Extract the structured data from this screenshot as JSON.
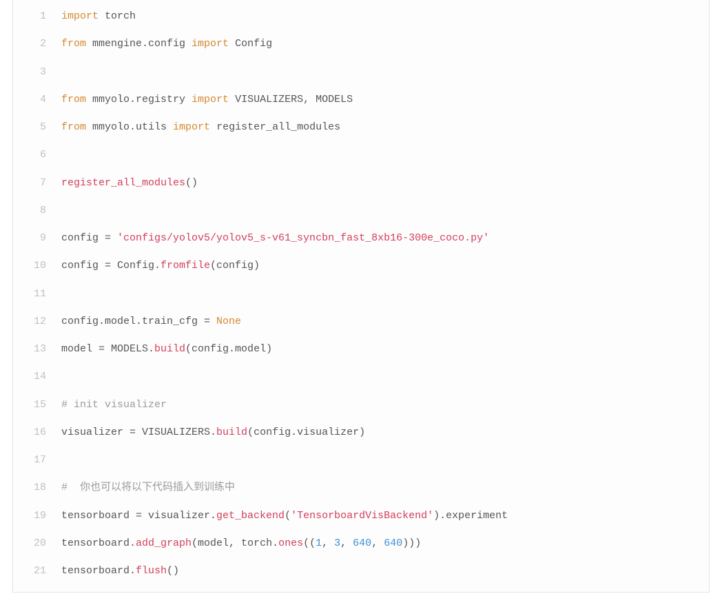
{
  "code": {
    "lines": [
      {
        "n": "1",
        "tokens": [
          {
            "cls": "tok-k",
            "t": "import"
          },
          {
            "cls": "tok-p",
            "t": " torch"
          }
        ]
      },
      {
        "n": "2",
        "tokens": [
          {
            "cls": "tok-k",
            "t": "from"
          },
          {
            "cls": "tok-p",
            "t": " mmengine.config "
          },
          {
            "cls": "tok-k",
            "t": "import"
          },
          {
            "cls": "tok-p",
            "t": " Config"
          }
        ]
      },
      {
        "n": "3",
        "tokens": []
      },
      {
        "n": "4",
        "tokens": [
          {
            "cls": "tok-k",
            "t": "from"
          },
          {
            "cls": "tok-p",
            "t": " mmyolo.registry "
          },
          {
            "cls": "tok-k",
            "t": "import"
          },
          {
            "cls": "tok-p",
            "t": " VISUALIZERS, MODELS"
          }
        ]
      },
      {
        "n": "5",
        "tokens": [
          {
            "cls": "tok-k",
            "t": "from"
          },
          {
            "cls": "tok-p",
            "t": " mmyolo.utils "
          },
          {
            "cls": "tok-k",
            "t": "import"
          },
          {
            "cls": "tok-p",
            "t": " register_all_modules"
          }
        ]
      },
      {
        "n": "6",
        "tokens": []
      },
      {
        "n": "7",
        "tokens": [
          {
            "cls": "tok-fn",
            "t": "register_all_modules"
          },
          {
            "cls": "tok-p",
            "t": "()"
          }
        ]
      },
      {
        "n": "8",
        "tokens": []
      },
      {
        "n": "9",
        "tokens": [
          {
            "cls": "tok-p",
            "t": "config = "
          },
          {
            "cls": "tok-s",
            "t": "'configs/yolov5/yolov5_s-v61_syncbn_fast_8xb16-300e_coco.py'"
          }
        ]
      },
      {
        "n": "10",
        "tokens": [
          {
            "cls": "tok-p",
            "t": "config = Config."
          },
          {
            "cls": "tok-fn",
            "t": "fromfile"
          },
          {
            "cls": "tok-p",
            "t": "(config)"
          }
        ]
      },
      {
        "n": "11",
        "tokens": []
      },
      {
        "n": "12",
        "tokens": [
          {
            "cls": "tok-p",
            "t": "config.model.train_cfg = "
          },
          {
            "cls": "tok-k",
            "t": "None"
          }
        ]
      },
      {
        "n": "13",
        "tokens": [
          {
            "cls": "tok-p",
            "t": "model = MODELS."
          },
          {
            "cls": "tok-fn",
            "t": "build"
          },
          {
            "cls": "tok-p",
            "t": "(config.model)"
          }
        ]
      },
      {
        "n": "14",
        "tokens": []
      },
      {
        "n": "15",
        "tokens": [
          {
            "cls": "tok-c",
            "t": "# init visualizer"
          }
        ]
      },
      {
        "n": "16",
        "tokens": [
          {
            "cls": "tok-p",
            "t": "visualizer = VISUALIZERS."
          },
          {
            "cls": "tok-fn",
            "t": "build"
          },
          {
            "cls": "tok-p",
            "t": "(config.visualizer)"
          }
        ]
      },
      {
        "n": "17",
        "tokens": []
      },
      {
        "n": "18",
        "tokens": [
          {
            "cls": "tok-c",
            "t": "#  你也可以将以下代码插入到训练中"
          }
        ]
      },
      {
        "n": "19",
        "tokens": [
          {
            "cls": "tok-p",
            "t": "tensorboard = visualizer."
          },
          {
            "cls": "tok-fn",
            "t": "get_backend"
          },
          {
            "cls": "tok-p",
            "t": "("
          },
          {
            "cls": "tok-s",
            "t": "'TensorboardVisBackend'"
          },
          {
            "cls": "tok-p",
            "t": ").experiment"
          }
        ]
      },
      {
        "n": "20",
        "tokens": [
          {
            "cls": "tok-p",
            "t": "tensorboard."
          },
          {
            "cls": "tok-fn",
            "t": "add_graph"
          },
          {
            "cls": "tok-p",
            "t": "(model, torch."
          },
          {
            "cls": "tok-fn",
            "t": "ones"
          },
          {
            "cls": "tok-p",
            "t": "(("
          },
          {
            "cls": "tok-n",
            "t": "1"
          },
          {
            "cls": "tok-p",
            "t": ", "
          },
          {
            "cls": "tok-n",
            "t": "3"
          },
          {
            "cls": "tok-p",
            "t": ", "
          },
          {
            "cls": "tok-n",
            "t": "640"
          },
          {
            "cls": "tok-p",
            "t": ", "
          },
          {
            "cls": "tok-n",
            "t": "640"
          },
          {
            "cls": "tok-p",
            "t": ")))"
          }
        ]
      },
      {
        "n": "21",
        "tokens": [
          {
            "cls": "tok-p",
            "t": "tensorboard."
          },
          {
            "cls": "tok-fn",
            "t": "flush"
          },
          {
            "cls": "tok-p",
            "t": "()"
          }
        ]
      }
    ]
  }
}
